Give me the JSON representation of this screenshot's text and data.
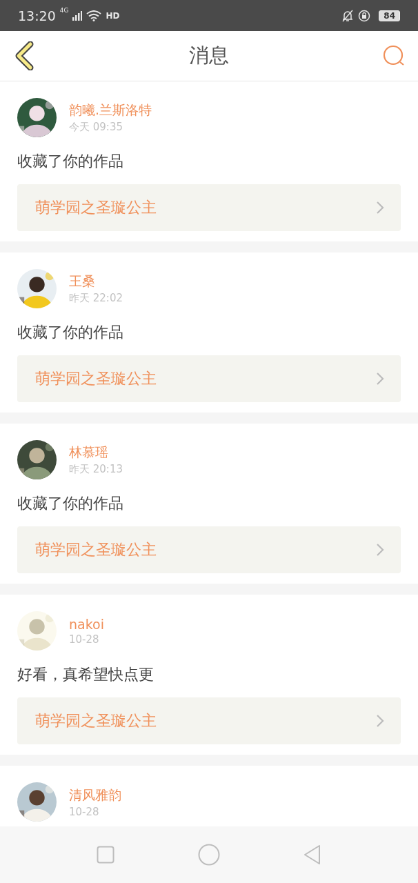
{
  "status_bar": {
    "time": "13:20",
    "network": "4G",
    "call_badge": "HD",
    "battery": "84"
  },
  "header": {
    "title": "消息"
  },
  "messages": [
    {
      "name": "韵曦.兰斯洛特",
      "time": "今天 09:35",
      "text": "收藏了你的作品",
      "work": "萌学园之圣璇公主"
    },
    {
      "name": "王桑",
      "time": "昨天 22:02",
      "text": "收藏了你的作品",
      "work": "萌学园之圣璇公主"
    },
    {
      "name": "林慕瑶",
      "time": "昨天 20:13",
      "text": "收藏了你的作品",
      "work": "萌学园之圣璇公主"
    },
    {
      "name": "nakoi",
      "time": "10-28",
      "text": "好看，真希望快点更",
      "work": "萌学园之圣璇公主"
    },
    {
      "name": "清风雅韵",
      "time": "10-28"
    }
  ]
}
